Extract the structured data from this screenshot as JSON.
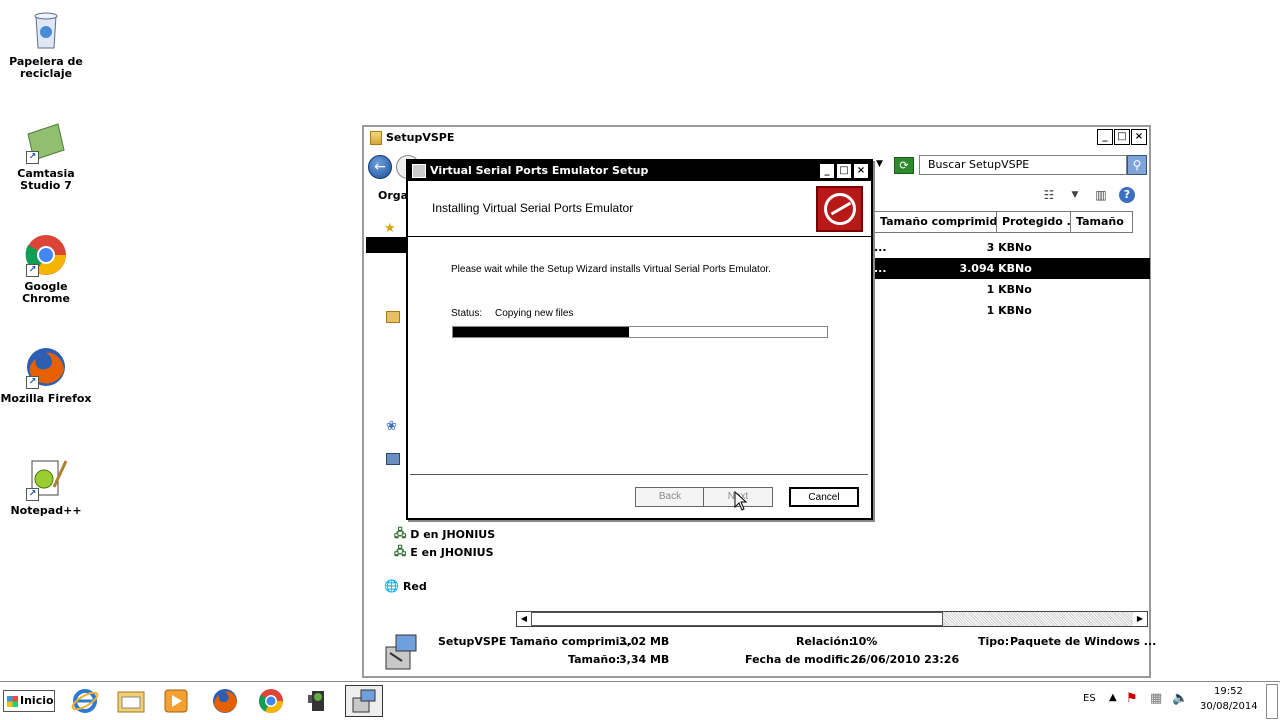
{
  "desktop": {
    "icons": [
      {
        "label": "Papelera de reciclaje",
        "icon": "recycle-bin"
      },
      {
        "label": "Camtasia Studio 7",
        "icon": "camtasia"
      },
      {
        "label": "Google Chrome",
        "icon": "chrome"
      },
      {
        "label": "Mozilla Firefox",
        "icon": "firefox"
      },
      {
        "label": "Notepad++",
        "icon": "notepad-plus-plus"
      }
    ]
  },
  "explorer": {
    "title": "SetupVSPE",
    "search_placeholder": "Buscar SetupVSPE",
    "organize_label": "Organ",
    "columns": [
      "Tamaño comprimido",
      "Protegido ...",
      "Tamaño"
    ],
    "rows": [
      {
        "dots": "...",
        "size": "3 KB",
        "protected": "No",
        "selected": false
      },
      {
        "dots": "...",
        "size": "3.094 KB",
        "protected": "No",
        "selected": true
      },
      {
        "dots": "",
        "size": "1 KB",
        "protected": "No",
        "selected": false
      },
      {
        "dots": "",
        "size": "1 KB",
        "protected": "No",
        "selected": false
      }
    ],
    "nav": {
      "drive_d": "D en JHONIUS",
      "drive_e": "E en JHONIUS",
      "network": "Red"
    },
    "status": {
      "name": "SetupVSPE",
      "compressed_label": "Tamaño comprimi...",
      "compressed_value": "3,02 MB",
      "size_label": "Tamaño:",
      "size_value": "3,34 MB",
      "ratio_label": "Relación:",
      "ratio_value": "10%",
      "modified_label": "Fecha de modific...",
      "modified_value": "26/06/2010 23:26",
      "type_label": "Tipo:",
      "type_value": "Paquete de Windows ..."
    }
  },
  "dialog": {
    "title": "Virtual Serial Ports Emulator Setup",
    "heading": "Installing Virtual Serial Ports Emulator",
    "message": "Please wait while the Setup Wizard installs Virtual Serial Ports Emulator.",
    "status_label": "Status:",
    "status_value": "Copying new files",
    "progress_fraction": 0.47,
    "back_label": "Back",
    "next_label": "Next",
    "cancel_label": "Cancel"
  },
  "taskbar": {
    "start_label": "Inicio",
    "apps": [
      "internet-explorer",
      "file-explorer",
      "media-player",
      "firefox",
      "chrome",
      "camcorder",
      "setup-installer"
    ],
    "language": "ES",
    "time": "19:52",
    "date": "30/08/2014"
  }
}
